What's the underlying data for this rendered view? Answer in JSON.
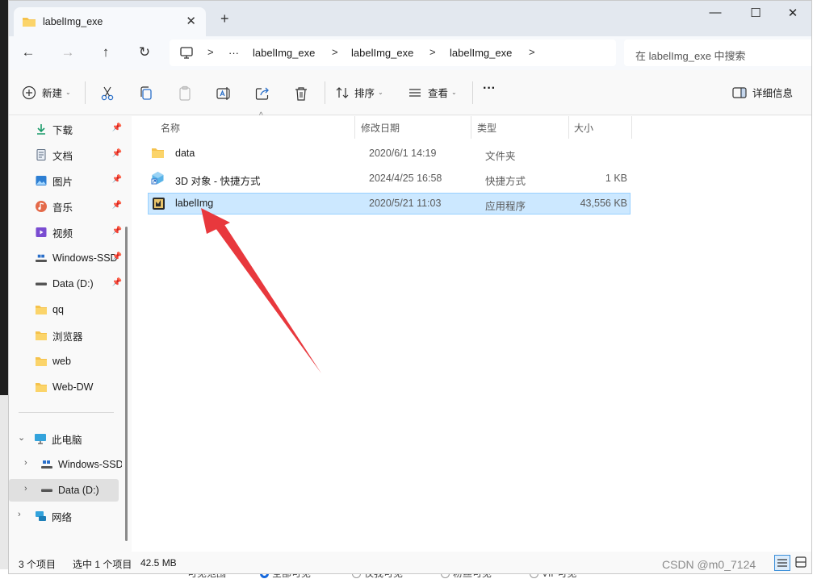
{
  "tab": {
    "title": "labelImg_exe",
    "close": "✕",
    "new_tab": "+"
  },
  "window_controls": {
    "minimize": "—",
    "maximize": "☐",
    "close": "✕"
  },
  "nav": {
    "back": "←",
    "forward": "→",
    "up": "↑",
    "refresh": "↻",
    "more": "···",
    "breadcrumbs": [
      "labelImg_exe",
      "labelImg_exe",
      "labelImg_exe"
    ],
    "separator": ">",
    "search_placeholder": "在 labelImg_exe 中搜索"
  },
  "toolbar": {
    "new": "新建",
    "sort": "排序",
    "view": "查看",
    "more": "···",
    "details": "详细信息"
  },
  "sidebar": {
    "quick_access": [
      {
        "label": "下载",
        "icon": "download-icon"
      },
      {
        "label": "文档",
        "icon": "document-icon"
      },
      {
        "label": "图片",
        "icon": "pictures-icon"
      },
      {
        "label": "音乐",
        "icon": "music-icon"
      },
      {
        "label": "视频",
        "icon": "video-icon"
      },
      {
        "label": "Windows-SSD",
        "icon": "drive-icon"
      },
      {
        "label": "Data (D:)",
        "icon": "drive-icon"
      }
    ],
    "folders": [
      "qq",
      "浏览器",
      "web",
      "Web-DW"
    ],
    "pin_glyph": "📌",
    "this_pc": "此电脑",
    "this_pc_children": [
      "Windows-SSD",
      "Data (D:)"
    ],
    "network": "网络"
  },
  "columns": {
    "name": "名称",
    "modified": "修改日期",
    "type": "类型",
    "size": "大小"
  },
  "files": [
    {
      "name": "data",
      "modified": "2020/6/1 14:19",
      "type": "文件夹",
      "size": "",
      "icon": "folder-icon"
    },
    {
      "name": "3D 对象 - 快捷方式",
      "modified": "2024/4/25 16:58",
      "type": "快捷方式",
      "size": "1 KB",
      "icon": "3d-objects-shortcut-icon"
    },
    {
      "name": "labelImg",
      "modified": "2020/5/21 11:03",
      "type": "应用程序",
      "size": "43,556 KB",
      "icon": "labelimg-app-icon"
    }
  ],
  "status": {
    "item_count": "3 个项目",
    "selected": "选中 1 个项目",
    "selected_size": "42.5 MB"
  },
  "watermark": "CSDN @m0_7124",
  "behind_window": {
    "label_visible_range": "可见范围",
    "options": [
      "全部可见",
      "仅我可见",
      "粉丝可见",
      "VIP可见"
    ]
  },
  "colors": {
    "accent": "#1668dc",
    "selection": "#cce8ff",
    "selection_border": "#99d1ff",
    "folder": "#f5c24c",
    "arrow": "#e8383d"
  }
}
